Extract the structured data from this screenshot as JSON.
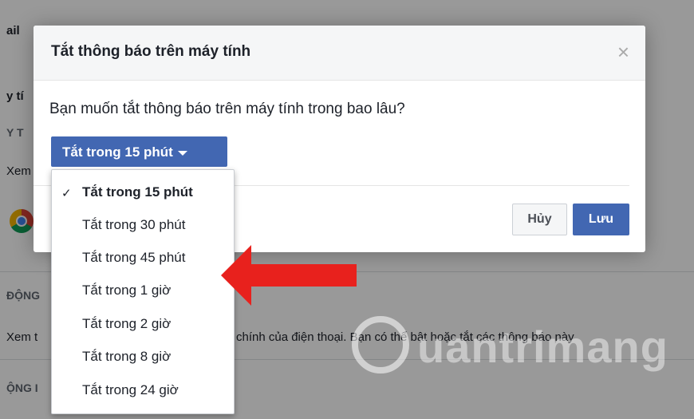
{
  "background": {
    "fragments": [
      {
        "text": "ail",
        "muted": false
      },
      {
        "text": "y tí",
        "muted": false
      },
      {
        "text": "Y T",
        "muted": true
      },
      {
        "text": "Xem",
        "muted": false
      },
      {
        "text": "ĐỘNG",
        "muted": true
      },
      {
        "text": "Xem t",
        "muted": false
      },
      {
        "text": "chính của điện thoại. Bạn có thể bật hoặc tắt các thông báo này",
        "muted": false
      },
      {
        "text": "ỘNG I",
        "muted": true
      }
    ],
    "app_icon": "chrome-icon"
  },
  "dialog": {
    "title": "Tắt thông báo trên máy tính",
    "close_icon": "×",
    "question": "Bạn muốn tắt thông báo trên máy tính trong bao lâu?",
    "dropdown": {
      "selected_label": "Tắt trong 15 phút",
      "options": [
        "Tắt trong 15 phút",
        "Tắt trong 30 phút",
        "Tắt trong 45 phút",
        "Tắt trong 1 giờ",
        "Tắt trong 2 giờ",
        "Tắt trong 8 giờ",
        "Tắt trong 24 giờ"
      ],
      "checkmark": "✓"
    },
    "cancel_label": "Hủy",
    "save_label": "Lưu"
  },
  "colors": {
    "accent": "#4267b2",
    "arrow": "#e8211d",
    "overlay": "rgba(0,0,0,0.40)"
  },
  "watermark": {
    "text": "uantrimang"
  }
}
